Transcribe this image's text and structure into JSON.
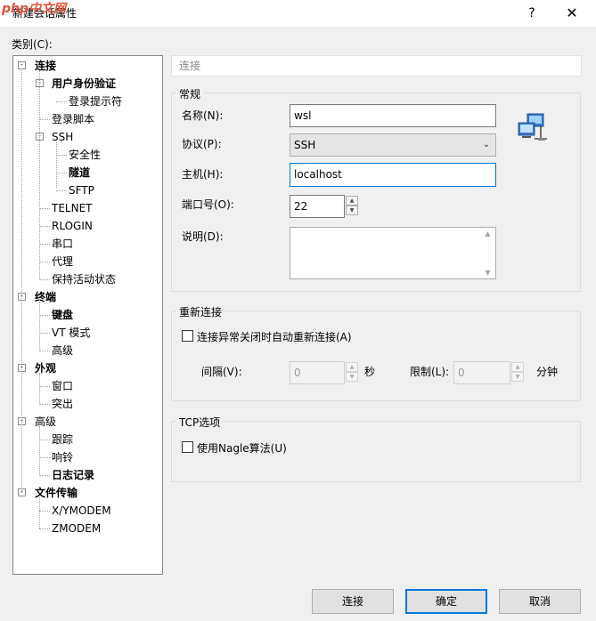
{
  "window": {
    "title": "新建会话属性",
    "watermark": "php中文网",
    "help_label": "?",
    "close_label": "✕"
  },
  "category_label": "类别(C):",
  "tree": {
    "items": [
      {
        "label": "连接",
        "level": 0,
        "bold": true,
        "toggle": "-"
      },
      {
        "label": "用户身份验证",
        "level": 1,
        "bold": true,
        "toggle": "-"
      },
      {
        "label": "登录提示符",
        "level": 2,
        "bold": false,
        "toggle": ""
      },
      {
        "label": "登录脚本",
        "level": 1,
        "bold": false,
        "toggle": ""
      },
      {
        "label": "SSH",
        "level": 1,
        "bold": false,
        "toggle": "-"
      },
      {
        "label": "安全性",
        "level": 2,
        "bold": false,
        "toggle": ""
      },
      {
        "label": "隧道",
        "level": 2,
        "bold": true,
        "toggle": ""
      },
      {
        "label": "SFTP",
        "level": 2,
        "bold": false,
        "toggle": ""
      },
      {
        "label": "TELNET",
        "level": 1,
        "bold": false,
        "toggle": ""
      },
      {
        "label": "RLOGIN",
        "level": 1,
        "bold": false,
        "toggle": ""
      },
      {
        "label": "串口",
        "level": 1,
        "bold": false,
        "toggle": ""
      },
      {
        "label": "代理",
        "level": 1,
        "bold": false,
        "toggle": ""
      },
      {
        "label": "保持活动状态",
        "level": 1,
        "bold": false,
        "toggle": ""
      },
      {
        "label": "终端",
        "level": 0,
        "bold": true,
        "toggle": "-"
      },
      {
        "label": "键盘",
        "level": 1,
        "bold": true,
        "toggle": ""
      },
      {
        "label": "VT 模式",
        "level": 1,
        "bold": false,
        "toggle": ""
      },
      {
        "label": "高级",
        "level": 1,
        "bold": false,
        "toggle": ""
      },
      {
        "label": "外观",
        "level": 0,
        "bold": true,
        "toggle": "-"
      },
      {
        "label": "窗口",
        "level": 1,
        "bold": false,
        "toggle": ""
      },
      {
        "label": "突出",
        "level": 1,
        "bold": false,
        "toggle": ""
      },
      {
        "label": "高级",
        "level": 0,
        "bold": false,
        "toggle": "-"
      },
      {
        "label": "跟踪",
        "level": 1,
        "bold": false,
        "toggle": ""
      },
      {
        "label": "响铃",
        "level": 1,
        "bold": false,
        "toggle": ""
      },
      {
        "label": "日志记录",
        "level": 1,
        "bold": true,
        "toggle": ""
      },
      {
        "label": "文件传输",
        "level": 0,
        "bold": true,
        "toggle": "-"
      },
      {
        "label": "X/YMODEM",
        "level": 1,
        "bold": false,
        "toggle": ""
      },
      {
        "label": "ZMODEM",
        "level": 1,
        "bold": false,
        "toggle": ""
      }
    ]
  },
  "breadcrumb": "连接",
  "general": {
    "group_title": "常规",
    "name_label": "名称(N):",
    "name_value": "wsl",
    "protocol_label": "协议(P):",
    "protocol_value": "SSH",
    "host_label": "主机(H):",
    "host_value": "localhost",
    "port_label": "端口号(O):",
    "port_value": "22",
    "desc_label": "说明(D):",
    "desc_value": ""
  },
  "reconnect": {
    "group_title": "重新连接",
    "checkbox_label": "连接异常关闭时自动重新连接(A)",
    "checked": false,
    "interval_label": "间隔(V):",
    "interval_value": "0",
    "interval_unit": "秒",
    "limit_label": "限制(L):",
    "limit_value": "0",
    "limit_unit": "分钟"
  },
  "tcp": {
    "group_title": "TCP选项",
    "nagle_label": "使用Nagle算法(U)",
    "checked": false
  },
  "buttons": {
    "connect": "连接",
    "ok": "确定",
    "cancel": "取消"
  },
  "colors": {
    "accent": "#0078d7",
    "watermark": "#e0553c"
  },
  "icons": {
    "network": "network-computers-icon"
  }
}
